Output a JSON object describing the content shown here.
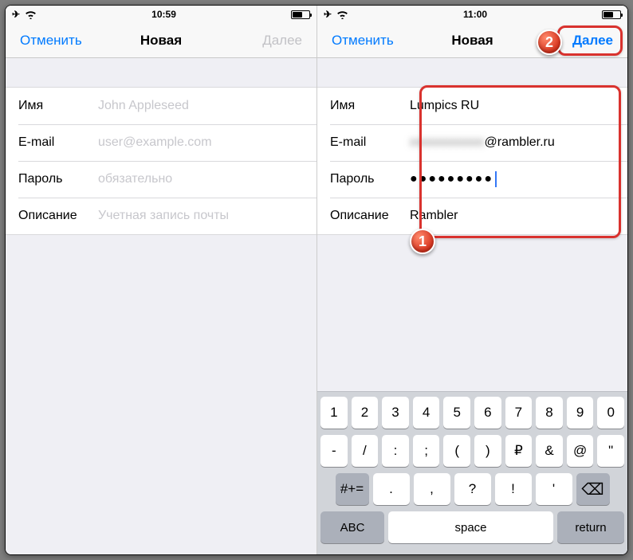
{
  "left": {
    "status": {
      "time": "10:59"
    },
    "nav": {
      "cancel": "Отменить",
      "title": "Новая",
      "next": "Далее"
    },
    "rows": {
      "name": {
        "label": "Имя",
        "placeholder": "John Appleseed",
        "value": ""
      },
      "email": {
        "label": "E-mail",
        "placeholder": "user@example.com",
        "value": ""
      },
      "password": {
        "label": "Пароль",
        "placeholder": "обязательно",
        "value": ""
      },
      "desc": {
        "label": "Описание",
        "placeholder": "Учетная запись почты",
        "value": ""
      }
    }
  },
  "right": {
    "status": {
      "time": "11:00"
    },
    "nav": {
      "cancel": "Отменить",
      "title": "Новая",
      "next": "Далее"
    },
    "rows": {
      "name": {
        "label": "Имя",
        "value": "Lumpics RU"
      },
      "email": {
        "label": "E-mail",
        "suffix": "@rambler.ru",
        "hidden": "xxxxxxxxxxx"
      },
      "password": {
        "label": "Пароль",
        "value": "●●●●●●●●●"
      },
      "desc": {
        "label": "Описание",
        "value": "Rambler"
      }
    },
    "keyboard": {
      "r1": [
        "1",
        "2",
        "3",
        "4",
        "5",
        "6",
        "7",
        "8",
        "9",
        "0"
      ],
      "r2": [
        "-",
        "/",
        ":",
        ";",
        "(",
        ")",
        "₽",
        "&",
        "@",
        "\""
      ],
      "shift": "#+=",
      "r3": [
        ".",
        ",",
        "?",
        "!",
        "'"
      ],
      "bottom": {
        "abc": "ABC",
        "space": "space",
        "return": "return"
      }
    },
    "badges": {
      "one": "1",
      "two": "2"
    }
  }
}
